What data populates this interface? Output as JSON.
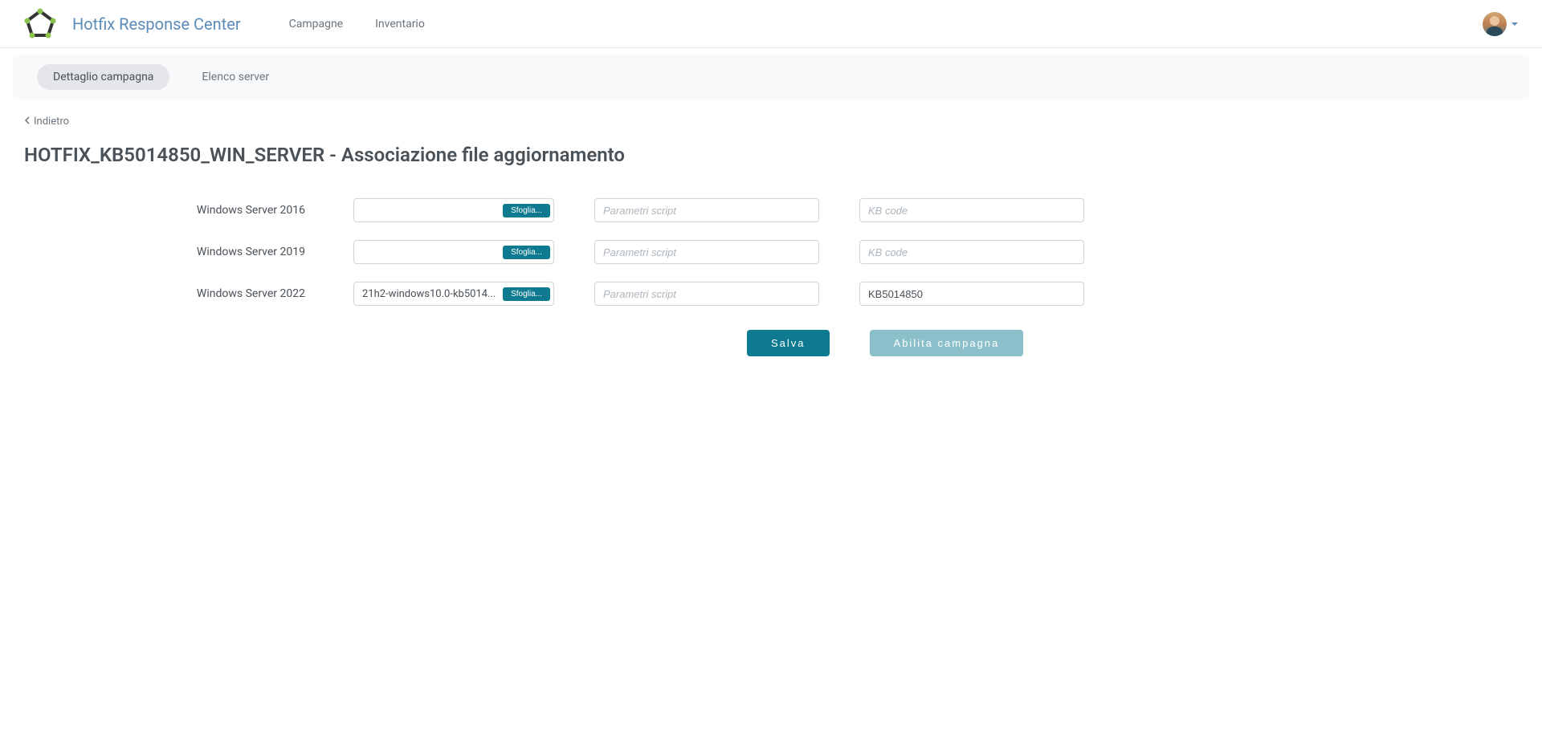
{
  "header": {
    "brand": "Hotfix Response Center",
    "nav": {
      "campagne": "Campagne",
      "inventario": "Inventario"
    }
  },
  "tabs": {
    "dettaglio": "Dettaglio campagna",
    "elenco": "Elenco server"
  },
  "back": "Indietro",
  "page_title": "HOTFIX_KB5014850_WIN_SERVER - Associazione file aggiornamento",
  "placeholders": {
    "parametri": "Parametri script",
    "kb": "KB code"
  },
  "browse_label": "Sfoglia...",
  "rows": [
    {
      "label": "Windows Server 2016",
      "file": "",
      "parametri": "",
      "kb": ""
    },
    {
      "label": "Windows Server 2019",
      "file": "",
      "parametri": "",
      "kb": ""
    },
    {
      "label": "Windows Server 2022",
      "file": "21h2-windows10.0-kb5014...",
      "parametri": "",
      "kb": "KB5014850"
    }
  ],
  "actions": {
    "save": "Salva",
    "enable": "Abilita campagna"
  }
}
